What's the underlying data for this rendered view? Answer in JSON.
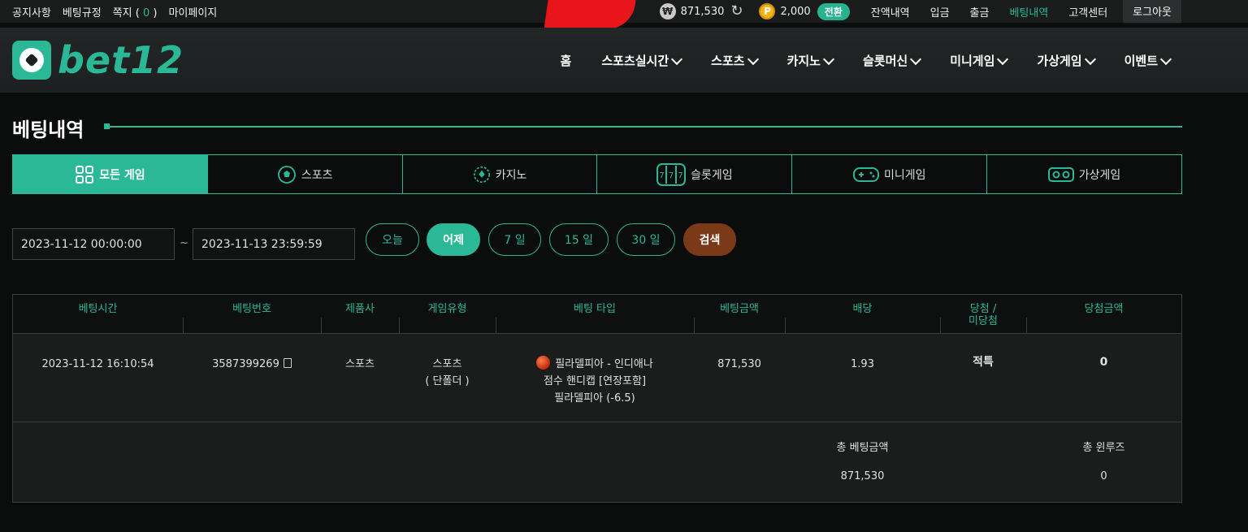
{
  "topbar": {
    "links": [
      "공지사항",
      "베팅규정"
    ],
    "note_label": "쪽지",
    "note_count": "0",
    "mypage": "마이페이지",
    "won_symbol": "₩",
    "balance": "871,530",
    "point_symbol": "P",
    "points": "2,000",
    "convert_label": "전환",
    "right_links": [
      "잔액내역",
      "입금",
      "출금",
      "베팅내역",
      "고객센터"
    ],
    "logout_label": "로그아웃"
  },
  "header": {
    "logo_text": "bet12",
    "nav": [
      "홈",
      "스포츠실시간",
      "스포츠",
      "카지노",
      "슬롯머신",
      "미니게임",
      "가상게임",
      "이벤트"
    ]
  },
  "page": {
    "title": "베팅내역"
  },
  "tabs": [
    {
      "label": "모든 게임",
      "icon": "grid-icon"
    },
    {
      "label": "스포츠",
      "icon": "soccer-icon"
    },
    {
      "label": "카지노",
      "icon": "casino-chip-icon"
    },
    {
      "label": "슬롯게임",
      "icon": "slot-icon"
    },
    {
      "label": "미니게임",
      "icon": "gamepad-icon"
    },
    {
      "label": "가상게임",
      "icon": "vr-icon"
    }
  ],
  "filter": {
    "start": "2023-11-12 00:00:00",
    "tilde": "~",
    "end": "2023-11-13 23:59:59",
    "buttons": [
      "오늘",
      "어제",
      "7 일",
      "15 일",
      "30 일"
    ],
    "search_label": "검색"
  },
  "table": {
    "headers": [
      "베팅시간",
      "베팅번호",
      "제품사",
      "게임유형",
      "베팅 타입",
      "베팅금액",
      "배당",
      "당첨 /\n미당첨",
      "당첨금액"
    ],
    "row": {
      "time": "2023-11-12 16:10:54",
      "number": "3587399269",
      "provider": "스포츠",
      "game_type": "스포츠",
      "game_sub": "( 단폴더 )",
      "bet_line1": "필라델피아 - 인디애나",
      "bet_line2": "점수 핸디캡 [연장포함]",
      "bet_line3": "필라델피아 (-6.5)",
      "amount": "871,530",
      "odds": "1.93",
      "result": "적특",
      "win_amount": "0"
    },
    "summary": {
      "total_bet_label": "총 베팅금액",
      "total_bet": "871,530",
      "total_win_label": "총 윈루즈",
      "total_win": "0"
    }
  }
}
